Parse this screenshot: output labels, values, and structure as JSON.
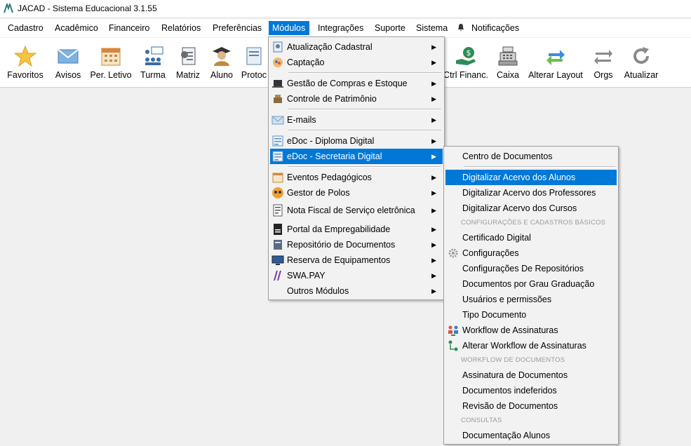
{
  "window": {
    "title": "JACAD - Sistema Educacional 3.1.55"
  },
  "menubar": {
    "items": [
      "Cadastro",
      "Acadêmico",
      "Financeiro",
      "Relatórios",
      "Preferências",
      "Módulos",
      "Integrações",
      "Suporte",
      "Sistema",
      "Notificações"
    ],
    "active": "Módulos"
  },
  "toolbar": {
    "buttons": [
      "Favoritos",
      "Avisos",
      "Per. Letivo",
      "Turma",
      "Matriz",
      "Aluno",
      "Protoc",
      "Ctrl Financ.",
      "Caixa",
      "Alterar Layout",
      "Orgs",
      "Atualizar"
    ]
  },
  "modulos_menu": {
    "items": [
      {
        "label": "Atualização Cadastral",
        "icon": "cadastral-icon"
      },
      {
        "label": "Captação",
        "icon": "captacao-icon"
      },
      {
        "label": "Gestão de Compras e Estoque",
        "icon": "compras-icon"
      },
      {
        "label": "Controle de Patrimônio",
        "icon": "patrimonio-icon"
      },
      {
        "label": "E-mails",
        "icon": "email-icon"
      },
      {
        "label": "eDoc - Diploma Digital",
        "icon": "edoc-diploma-icon"
      },
      {
        "label": "eDoc - Secretaria Digital",
        "icon": "edoc-secretaria-icon"
      },
      {
        "label": "Eventos Pedagógicos",
        "icon": "eventos-icon"
      },
      {
        "label": "Gestor de Polos",
        "icon": "polos-icon"
      },
      {
        "label": "Nota Fiscal de Serviço eletrônica",
        "icon": "nfse-icon"
      },
      {
        "label": "Portal da Empregabilidade",
        "icon": "cv-icon"
      },
      {
        "label": "Repositório de Documentos",
        "icon": "repositorio-icon"
      },
      {
        "label": "Reserva de Equipamentos",
        "icon": "monitor-icon"
      },
      {
        "label": "SWA.PAY",
        "icon": "swapay-icon"
      },
      {
        "label": "Outros Módulos",
        "icon": ""
      }
    ],
    "highlighted": "eDoc - Secretaria Digital"
  },
  "secretaria_submenu": {
    "items": [
      "Centro de Documentos",
      "Digitalizar Acervo dos Alunos",
      "Digitalizar Acervo dos Professores",
      "Digitalizar Acervo dos Cursos",
      "Certificado Digital",
      "Configurações",
      "Configurações De Repositórios",
      "Documentos por Grau Graduação",
      "Usuários e permissões",
      "Tipo Documento",
      "Workflow de Assinaturas",
      "Alterar Workflow de Assinaturas",
      "Assinatura de Documentos",
      "Documentos indeferidos",
      "Revisão de Documentos",
      "Documentação Alunos"
    ],
    "sections": [
      "CONFIGURAÇÕES E CADASTROS BÁSICOS",
      "WORKFLOW DE DOCUMENTOS",
      "CONSULTAS"
    ],
    "highlighted": "Digitalizar Acervo dos Alunos"
  },
  "colors": {
    "highlight": "#0078d7",
    "menu_bg": "#f2f2f2",
    "section_text": "#9a9a9a"
  }
}
